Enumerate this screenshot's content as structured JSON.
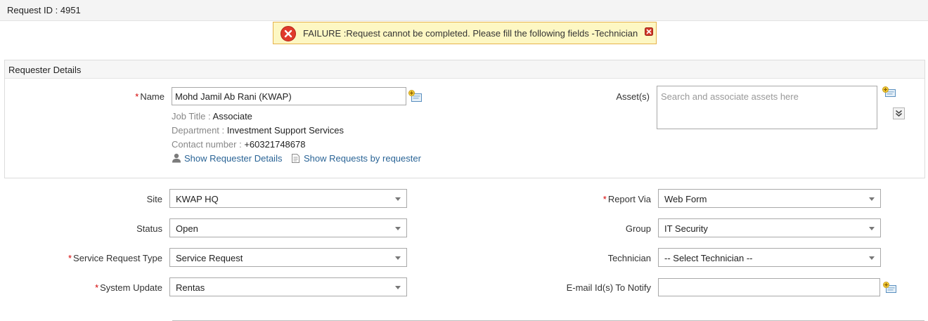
{
  "header": {
    "title": "Request ID : 4951"
  },
  "alert": {
    "message": "FAILURE :Request cannot be completed. Please fill the following fields -Technician",
    "icon": "error-circle-icon",
    "close_icon": "close-icon"
  },
  "requester_panel": {
    "title": "Requester Details",
    "name": {
      "label": "Name",
      "value": "Mohd Jamil Ab Rani (KWAP)",
      "required": true
    },
    "job_title": {
      "label": "Job Title :",
      "value": "Associate"
    },
    "department": {
      "label": "Department :",
      "value": "Investment Support Services"
    },
    "contact": {
      "label": "Contact number :",
      "value": "+60321748678"
    },
    "show_details_link": "Show Requester Details",
    "show_requests_link": "Show Requests by requester",
    "assets": {
      "label": "Asset(s)",
      "placeholder": "Search and associate assets here"
    }
  },
  "form": {
    "site": {
      "label": "Site",
      "value": "KWAP HQ"
    },
    "status": {
      "label": "Status",
      "value": "Open"
    },
    "service_request_type": {
      "label": "Service Request Type",
      "value": "Service Request",
      "required": true
    },
    "system_update": {
      "label": "System Update",
      "value": "Rentas",
      "required": true
    },
    "report_via": {
      "label": "Report Via",
      "value": "Web Form",
      "required": true
    },
    "group": {
      "label": "Group",
      "value": "IT Security"
    },
    "technician": {
      "label": "Technician",
      "value": "-- Select Technician --"
    },
    "email_notify": {
      "label": "E-mail Id(s) To Notify",
      "value": ""
    }
  },
  "colors": {
    "alert_bg": "#fdf7c3",
    "alert_border": "#e6b24d",
    "error_red": "#e0392b",
    "link_blue": "#2a6496",
    "required_red": "#d40000"
  }
}
